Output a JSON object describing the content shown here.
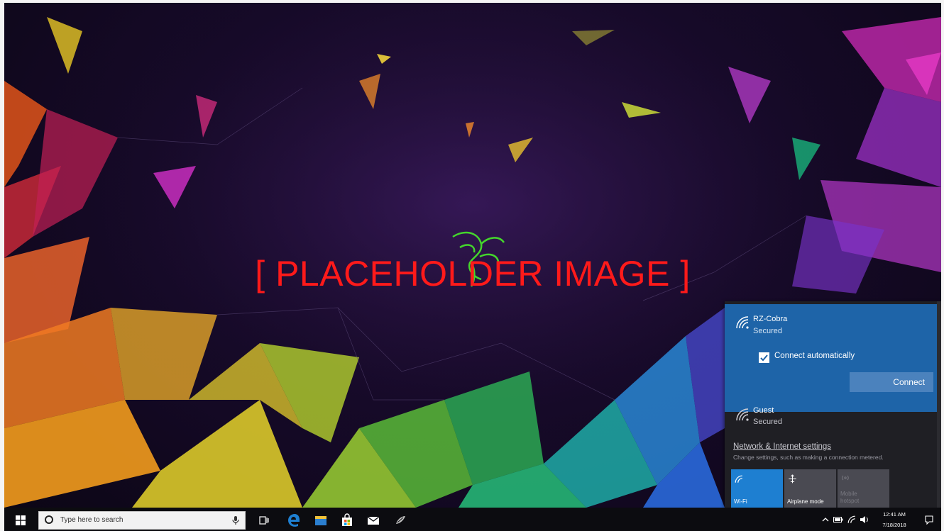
{
  "desktop": {
    "placeholder_label": "[ PLACEHOLDER IMAGE ]"
  },
  "network_flyout": {
    "networks": [
      {
        "name": "RZ-Cobra",
        "status": "Secured",
        "selected": true,
        "connect_automatically_label": "Connect automatically",
        "connect_automatically_checked": true,
        "connect_button_label": "Connect"
      },
      {
        "name": "Guest",
        "status": "Secured",
        "selected": false
      }
    ],
    "settings_link": "Network & Internet settings",
    "settings_description": "Change settings, such as making a connection metered.",
    "quick_actions": [
      {
        "label": "Wi-Fi",
        "icon": "wifi-icon",
        "active": true
      },
      {
        "label": "Airplane mode",
        "icon": "airplane-icon",
        "active": false
      },
      {
        "label_line1": "Mobile",
        "label_line2": "hotspot",
        "icon": "hotspot-icon",
        "active": false,
        "disabled": true
      }
    ]
  },
  "taskbar": {
    "search_placeholder": "Type here to search",
    "pinned_apps": [
      "task-view-icon",
      "edge-icon",
      "file-explorer-icon",
      "store-icon",
      "mail-icon",
      "razer-cortex-icon"
    ],
    "clock_time": "12:41 AM",
    "clock_date": "7/18/2018"
  },
  "colors": {
    "flyout_background": "#1f1f24",
    "selected_network": "#1e64a8",
    "accent": "#1e7fd1",
    "razer_green": "#44d62c",
    "taskbar": "#0c0c10"
  }
}
